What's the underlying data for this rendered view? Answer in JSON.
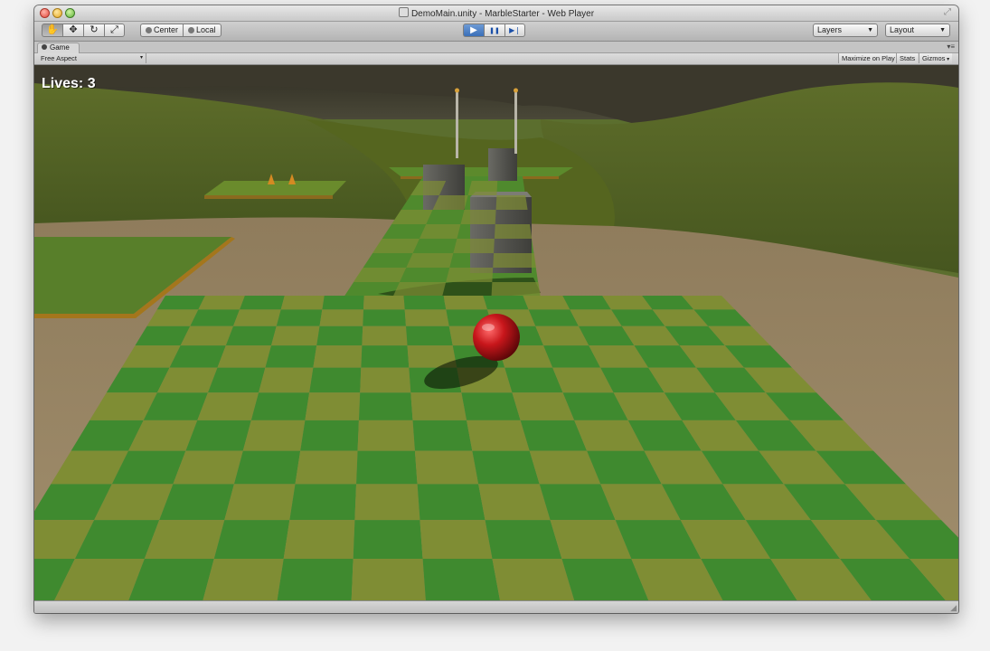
{
  "window": {
    "title": "DemoMain.unity - MarbleStarter - Web Player"
  },
  "toolbar": {
    "tools": [
      {
        "name": "hand-tool",
        "glyph": "✋"
      },
      {
        "name": "move-tool",
        "glyph": "✥"
      },
      {
        "name": "rotate-tool",
        "glyph": "↻"
      },
      {
        "name": "scale-tool",
        "glyph": "⤢"
      }
    ],
    "pivot_label": "Center",
    "space_label": "Local",
    "play_glyph": "▶",
    "pause_glyph": "❚❚",
    "step_glyph": "▶❘",
    "layers_label": "Layers",
    "layout_label": "Layout"
  },
  "tab": {
    "label": "Game"
  },
  "gamebar": {
    "aspect_label": "Free Aspect",
    "maximize_label": "Maximize on Play",
    "stats_label": "Stats",
    "gizmos_label": "Gizmos"
  },
  "hud": {
    "lives_text": "Lives: 3"
  },
  "colors": {
    "grass_dark": "#3f8a2f",
    "grass_light": "#7f8d34",
    "ball": "#c8161b",
    "hill": "#5b6b27",
    "dirt": "#9c8866",
    "rock": "#4a4a3a"
  }
}
